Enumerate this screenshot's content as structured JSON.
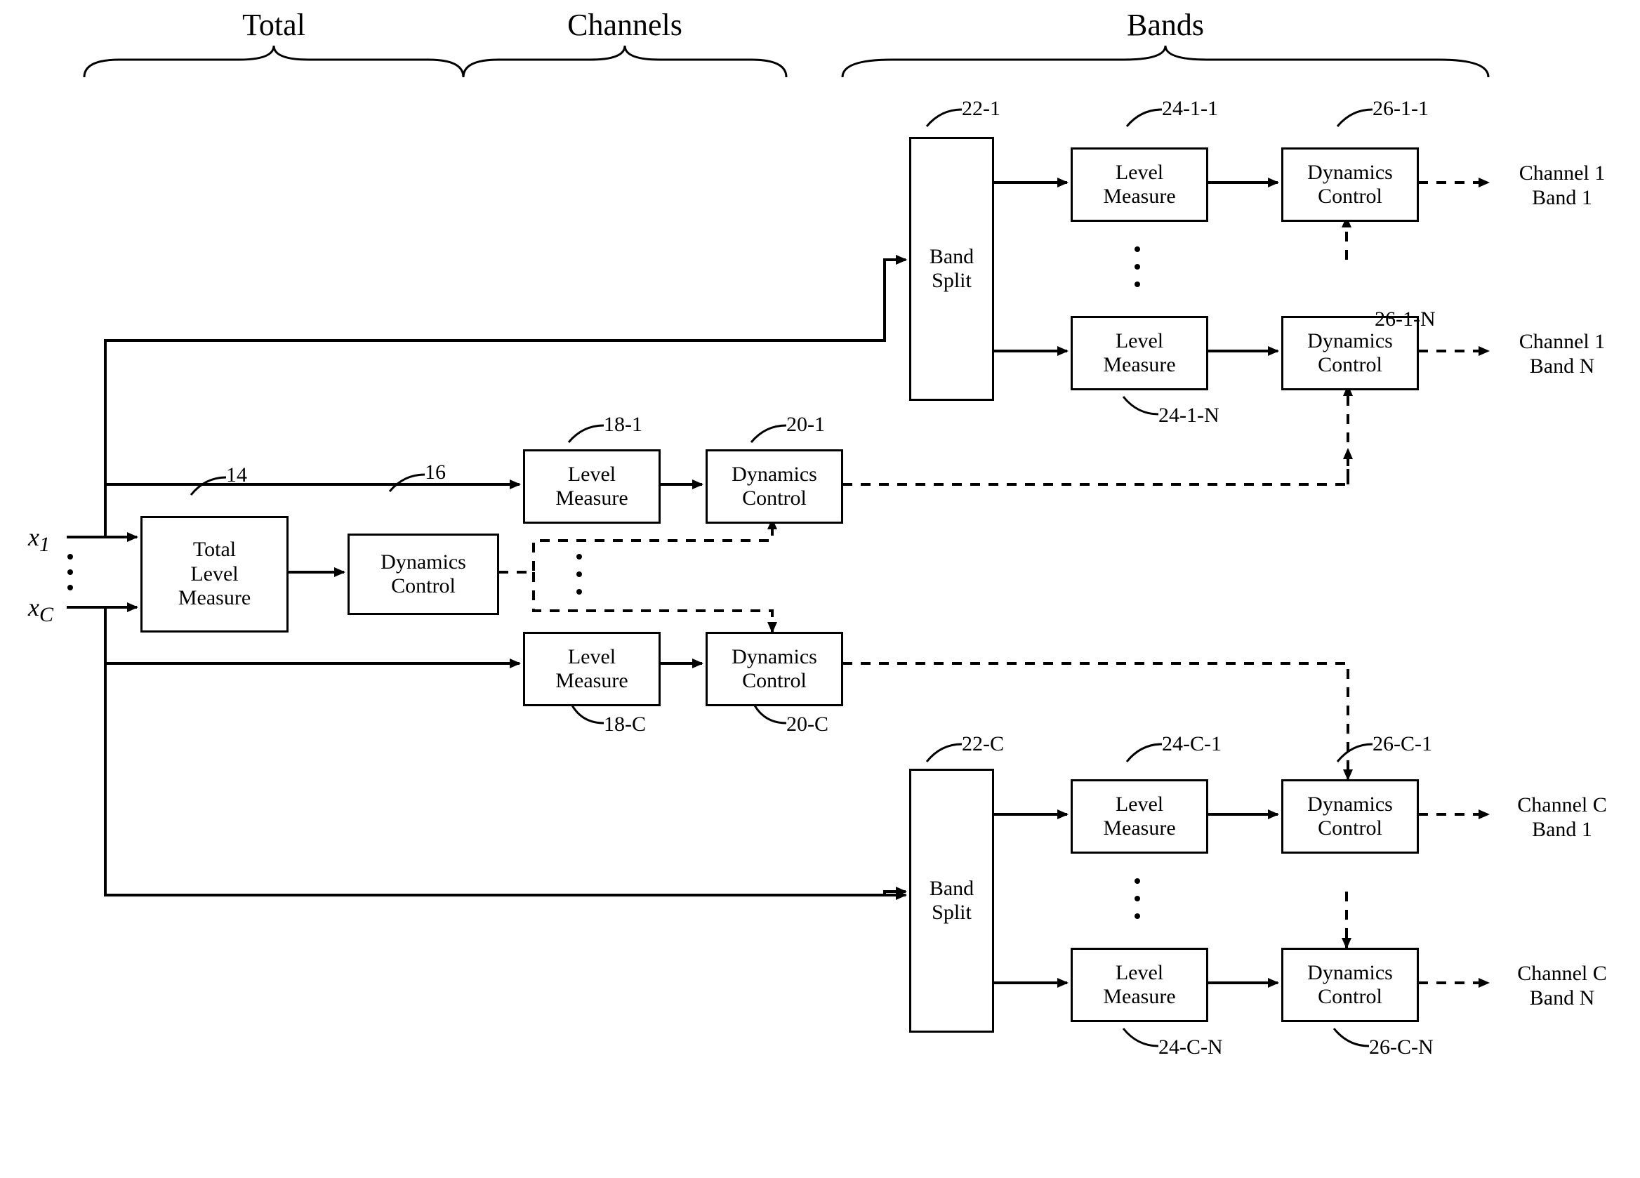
{
  "sections": {
    "total": "Total",
    "channels": "Channels",
    "bands": "Bands"
  },
  "inputs": {
    "x1": "x",
    "x1s": "1",
    "xc": "x",
    "xcs": "C"
  },
  "blocks": {
    "tlm": "Total\nLevel\nMeasure",
    "dyn": "Dynamics\nControl",
    "lvl": "Level\nMeasure",
    "bsplit": "Band\nSplit"
  },
  "refs": {
    "r14": "14",
    "r16": "16",
    "r18_1": "18-1",
    "r20_1": "20-1",
    "r18_c": "18-C",
    "r20_c": "20-C",
    "r22_1": "22-1",
    "r22_c": "22-C",
    "r24_1_1": "24-1-1",
    "r26_1_1": "26-1-1",
    "r24_1_n": "24-1-N",
    "r26_1_n": "26-1-N",
    "r24_c_1": "24-C-1",
    "r26_c_1": "26-C-1",
    "r24_c_n": "24-C-N",
    "r26_c_n": "26-C-N"
  },
  "outs": {
    "o11": "Channel 1\nBand 1",
    "o1n": "Channel 1\nBand N",
    "oc1": "Channel C\nBand 1",
    "ocn": "Channel C\nBand N"
  }
}
